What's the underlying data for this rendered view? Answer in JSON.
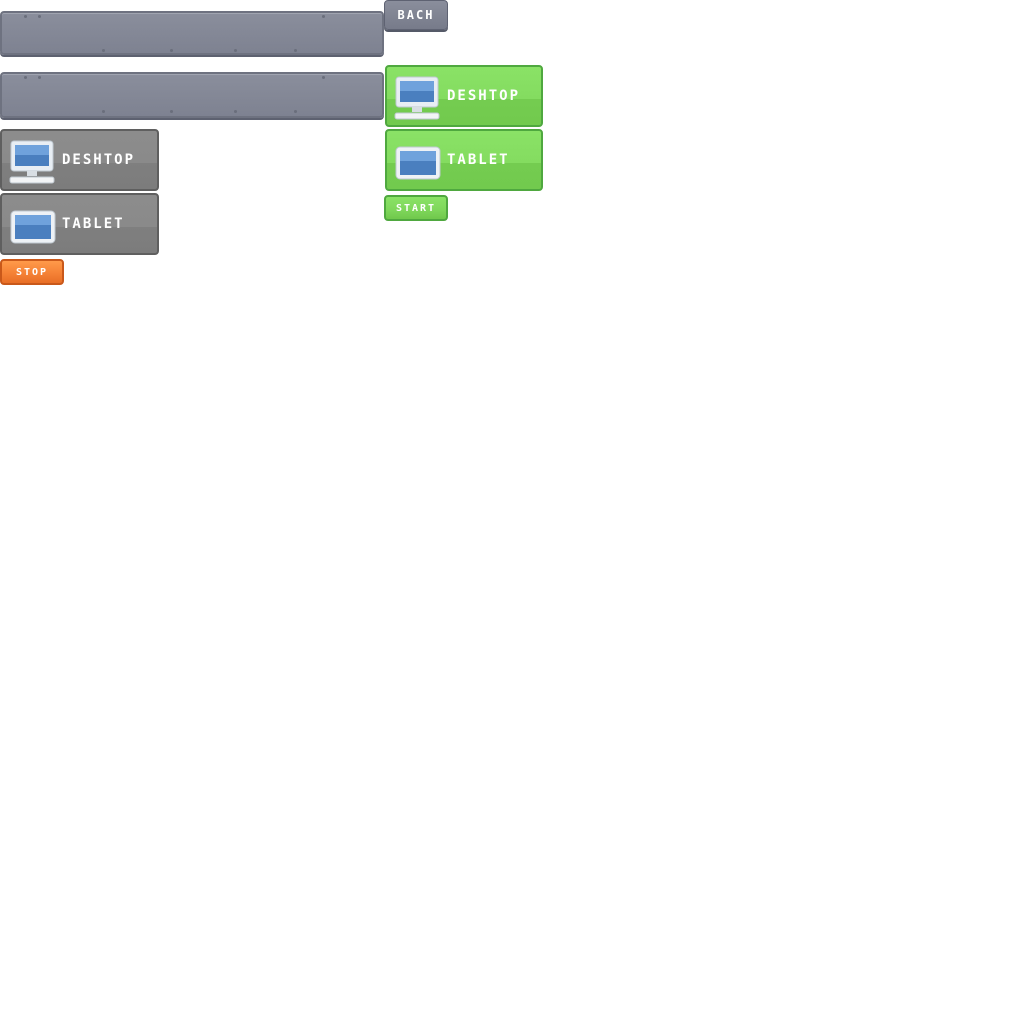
{
  "buttons": {
    "back_label": "BACH",
    "desktop_label": "DESHTOP",
    "tablet_label": "TABLET",
    "start_label": "START",
    "stop_label": "STOP"
  },
  "colors": {
    "bar": "#848896",
    "grey_tile": "#878787",
    "green_tile": "#7fd65b",
    "orange": "#f58236"
  },
  "icons": {
    "desktop": "desktop-computer-icon",
    "tablet": "tablet-icon"
  }
}
